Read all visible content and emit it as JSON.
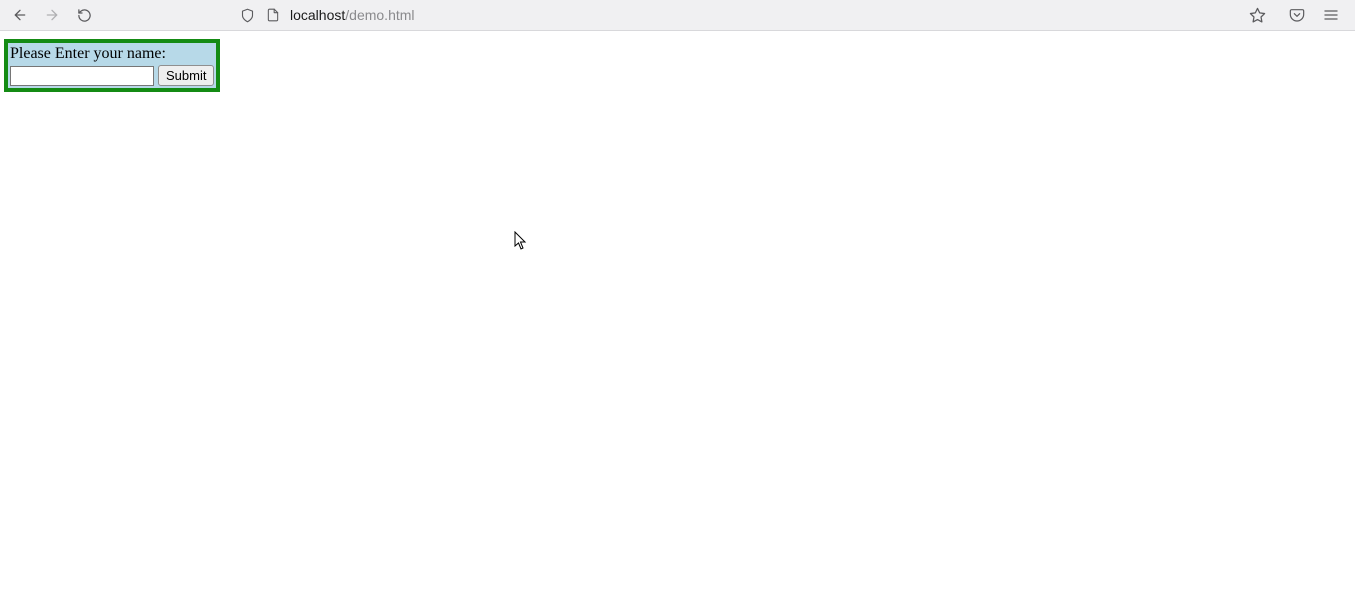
{
  "browser": {
    "url_host": "localhost",
    "url_path": "/demo.html"
  },
  "form": {
    "label": "Please Enter your name:",
    "input_value": "",
    "submit_label": "Submit"
  }
}
